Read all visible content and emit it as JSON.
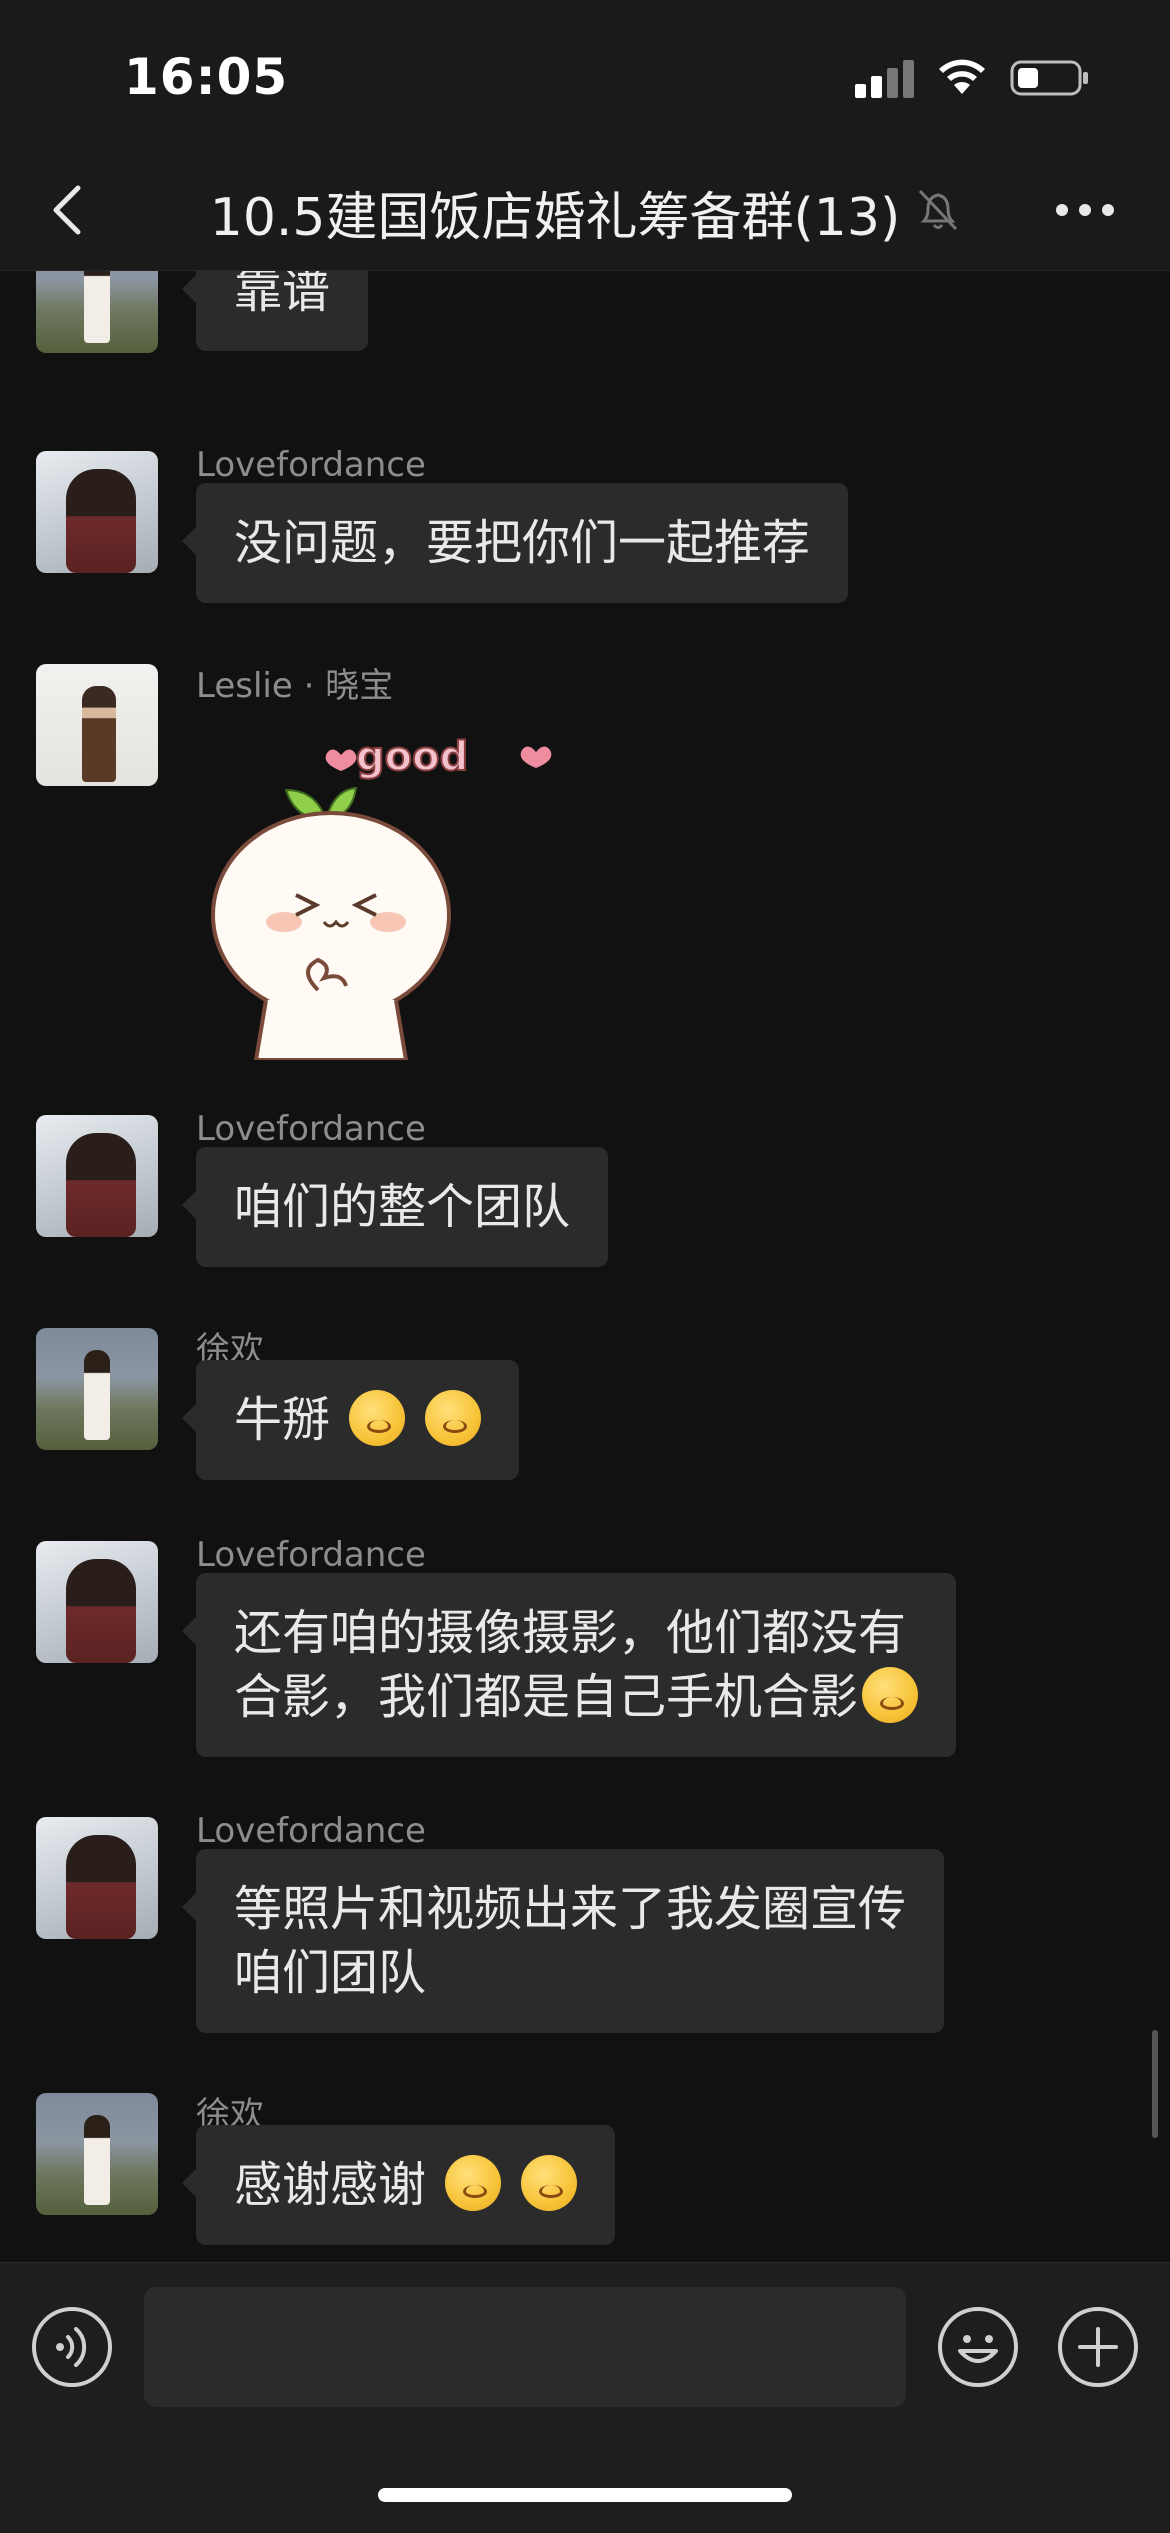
{
  "status_bar": {
    "time": "16:05"
  },
  "nav": {
    "title": "10.5建国饭店婚礼筹备群(13)",
    "muted": true
  },
  "messages": [
    {
      "sender": "",
      "avatar": "xuhuan",
      "text": "靠谱",
      "emojis": 0
    },
    {
      "sender": "Lovefordance",
      "avatar": "love",
      "text": "没问题，要把你们一起推荐",
      "emojis": 0
    },
    {
      "sender": "Leslie · 晓宝",
      "avatar": "leslie",
      "sticker": "good",
      "sticker_text": "good"
    },
    {
      "sender": "Lovefordance",
      "avatar": "love",
      "text": "咱们的整个团队",
      "emojis": 0
    },
    {
      "sender": "徐欢",
      "avatar": "xuhuan",
      "text": "牛掰",
      "emojis": 2
    },
    {
      "sender": "Lovefordance",
      "avatar": "love",
      "lines": [
        "还有咱的摄像摄影，他们都没有",
        "合影，我们都是自己手机合影"
      ],
      "emojis": 1
    },
    {
      "sender": "Lovefordance",
      "avatar": "love",
      "lines": [
        "等照片和视频出来了我发圈宣传",
        "咱们团队"
      ],
      "emojis": 0
    },
    {
      "sender": "徐欢",
      "avatar": "xuhuan",
      "text": "感谢感谢",
      "emojis": 2
    }
  ],
  "input": {
    "value": "",
    "placeholder": ""
  },
  "icons": {
    "back": "chevron-left-icon",
    "mute": "bell-slash-icon",
    "more": "ellipsis-icon",
    "voice": "voice-icon",
    "emoji": "smiley-icon",
    "plus": "plus-icon"
  },
  "colors": {
    "background": "#111111",
    "bubble": "#2b2b2b",
    "bar": "#1a1a1a"
  }
}
